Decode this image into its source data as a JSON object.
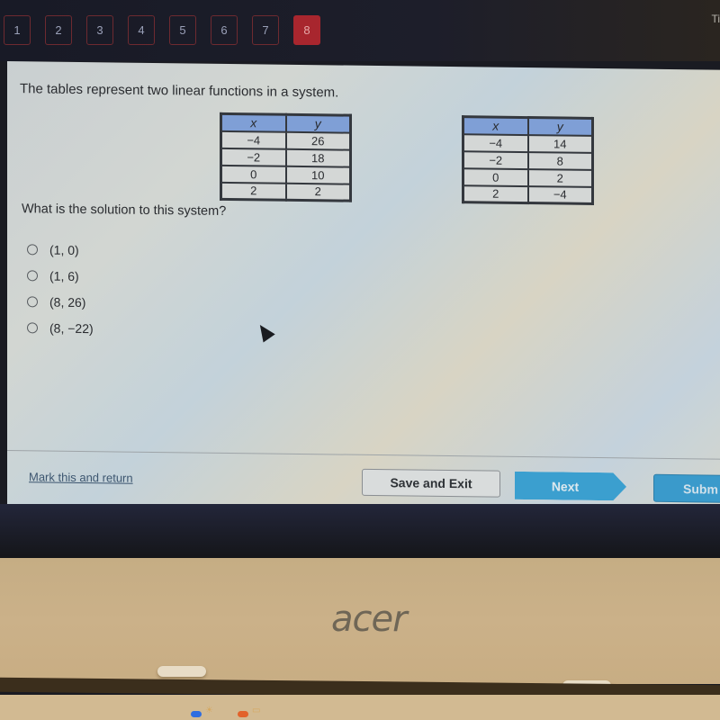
{
  "question_nav": {
    "items": [
      {
        "label": "1",
        "active": false
      },
      {
        "label": "2",
        "active": false
      },
      {
        "label": "3",
        "active": false
      },
      {
        "label": "4",
        "active": false
      },
      {
        "label": "5",
        "active": false
      },
      {
        "label": "6",
        "active": false
      },
      {
        "label": "7",
        "active": false
      },
      {
        "label": "8",
        "active": true
      }
    ],
    "timer_label_partial": "Ti"
  },
  "question": {
    "prompt": "The tables represent two linear functions in a system.",
    "table1": {
      "headers": [
        "x",
        "y"
      ],
      "rows": [
        [
          "−4",
          "26"
        ],
        [
          "−2",
          "18"
        ],
        [
          "0",
          "10"
        ],
        [
          "2",
          "2"
        ]
      ]
    },
    "table2": {
      "headers": [
        "x",
        "y"
      ],
      "rows": [
        [
          "−4",
          "14"
        ],
        [
          "−2",
          "8"
        ],
        [
          "0",
          "2"
        ],
        [
          "2",
          "−4"
        ]
      ]
    },
    "text": "What is the solution to this system?",
    "options": [
      {
        "label": "(1, 0)",
        "selected": false
      },
      {
        "label": "(1, 6)",
        "selected": false
      },
      {
        "label": "(8, 26)",
        "selected": false
      },
      {
        "label": "(8, −22)",
        "selected": false
      }
    ]
  },
  "footer": {
    "mark_link": "Mark this and return",
    "save_exit": "Save and Exit",
    "next": "Next",
    "submit_partial": "Subm"
  },
  "device": {
    "brand": "acer"
  }
}
